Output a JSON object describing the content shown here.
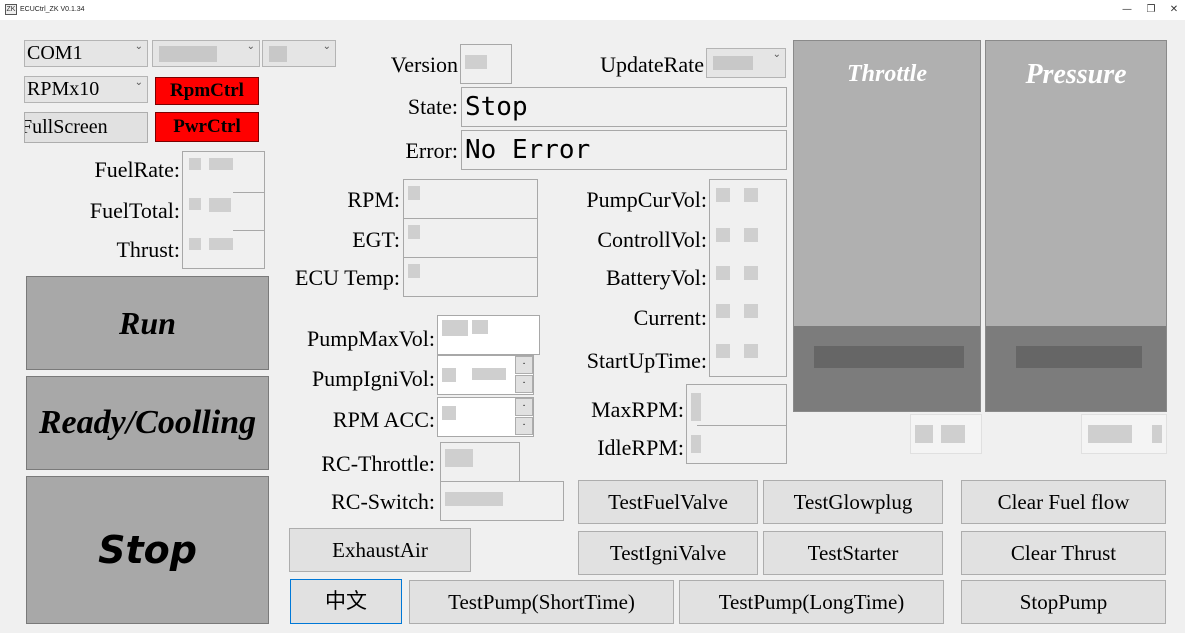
{
  "window": {
    "icon_text": "ZK",
    "title": "ECUCtrl_ZK V0.1.34",
    "minimize": "—",
    "restore": "❐",
    "close": "✕"
  },
  "connection": {
    "port": "COM1",
    "rpm_scale": "RPMx10",
    "fullscreen_label": "FullScreen",
    "rpm_ctrl_label": "RpmCtrl",
    "pwr_ctrl_label": "PwrCtrl"
  },
  "info": {
    "version_label": "Version",
    "update_rate_label": "UpdateRate",
    "state_label": "State:",
    "state_value": "Stop",
    "error_label": "Error:",
    "error_value": "No Error"
  },
  "left_metrics": {
    "fuel_rate_label": "FuelRate:",
    "fuel_total_label": "FuelTotal:",
    "thrust_label": "Thrust:"
  },
  "engine": {
    "rpm_label": "RPM:",
    "egt_label": "EGT:",
    "ecu_temp_label": "ECU Temp:"
  },
  "voltages": {
    "pump_cur_vol_label": "PumpCurVol:",
    "controll_vol_label": "ControllVol:",
    "battery_vol_label": "BatteryVol:",
    "current_label": "Current:",
    "startup_time_label": "StartUpTime:"
  },
  "settings": {
    "pump_max_vol_label": "PumpMaxVol:",
    "pump_igni_vol_label": "PumpIgniVol:",
    "rpm_acc_label": "RPM ACC:",
    "rc_throttle_label": "RC-Throttle:",
    "rc_switch_label": "RC-Switch:",
    "max_rpm_label": "MaxRPM:",
    "idle_rpm_label": "IdleRPM:"
  },
  "gauges": {
    "throttle_title": "Throttle",
    "pressure_title": "Pressure",
    "throttle_level": 0.23,
    "pressure_level": 0.23
  },
  "controls": {
    "run": "Run",
    "ready": "Ready/Coolling",
    "stop": "Stop",
    "exhaust_air": "ExhaustAir",
    "language": "中文",
    "test_fuel_valve": "TestFuelValve",
    "test_glowplug": "TestGlowplug",
    "test_igni_valve": "TestIgniValve",
    "test_starter": "TestStarter",
    "test_pump_short": "TestPump(ShortTime)",
    "test_pump_long": "TestPump(LongTime)",
    "clear_fuel_flow": "Clear Fuel flow",
    "clear_thrust": "Clear Thrust",
    "stop_pump": "StopPump"
  },
  "colors": {
    "accent_red": "#ff0000",
    "gauge_bg": "#b0b0b0",
    "gauge_fill": "#7c7c7c",
    "big_button_bg": "#a8a8a8"
  }
}
